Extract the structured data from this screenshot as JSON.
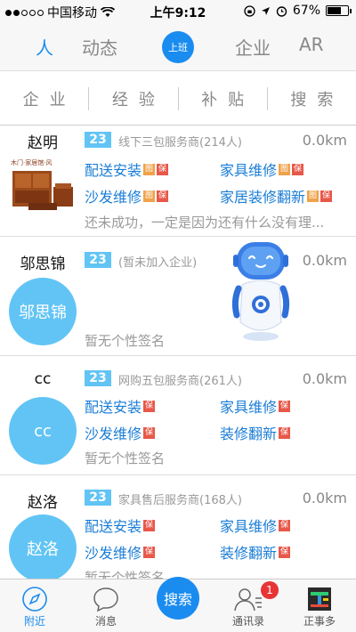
{
  "status": {
    "carrier": "中国移动",
    "time": "上午9:12",
    "battery": "67%",
    "battery_level": 0.67
  },
  "topnav": {
    "tabs": [
      {
        "label": "人",
        "active": true
      },
      {
        "label": "动态",
        "active": false
      },
      {
        "label": "企业",
        "active": false
      },
      {
        "label": "AR",
        "active": false
      }
    ],
    "center_button": "上班"
  },
  "filters": [
    "企业",
    "经验",
    "补贴",
    "搜索"
  ],
  "cards": [
    {
      "name": "赵明",
      "level": "23",
      "category": "线下三包服务商(214人)",
      "distance": "0.0km",
      "services": [
        {
          "label": "配送安装",
          "badges": [
            "图",
            "保"
          ]
        },
        {
          "label": "家具维修",
          "badges": [
            "图",
            "保"
          ]
        },
        {
          "label": "沙发维修",
          "badges": [
            "图",
            "保"
          ]
        },
        {
          "label": "家居装修翻新",
          "badges": [
            "图",
            "保"
          ]
        }
      ],
      "signature": "还未成功，一定是因为还有什么没有理..."
    },
    {
      "name": "邬思锦",
      "avatar_text": "邬思锦",
      "level": "23",
      "category": "(暂未加入企业)",
      "distance": "0.0km",
      "services": [],
      "signature": "暂无个性签名"
    },
    {
      "name": "cc",
      "avatar_text": "cc",
      "level": "23",
      "category": "网购五包服务商(261人)",
      "distance": "0.0km",
      "services": [
        {
          "label": "配送安装",
          "badges": [
            "保"
          ]
        },
        {
          "label": "家具维修",
          "badges": [
            "保"
          ]
        },
        {
          "label": "沙发维修",
          "badges": [
            "保"
          ]
        },
        {
          "label": "装修翻新",
          "badges": [
            "保"
          ]
        }
      ],
      "signature": "暂无个性签名"
    },
    {
      "name": "赵洛",
      "avatar_text": "赵洛",
      "level": "23",
      "category": "家具售后服务商(168人)",
      "distance": "0.0km",
      "services": [
        {
          "label": "配送安装",
          "badges": [
            "保"
          ]
        },
        {
          "label": "家具维修",
          "badges": [
            "保"
          ]
        },
        {
          "label": "沙发维修",
          "badges": [
            "保"
          ]
        },
        {
          "label": "装修翻新",
          "badges": [
            "保"
          ]
        }
      ],
      "signature": "暂无个性签名"
    }
  ],
  "tabbar": {
    "items": [
      {
        "label": "附近",
        "icon": "compass-icon",
        "active": true
      },
      {
        "label": "消息",
        "icon": "chat-bubble-icon"
      },
      {
        "label": "搜索",
        "icon": "search-button"
      },
      {
        "label": "通讯录",
        "icon": "contacts-icon",
        "badge": "1"
      },
      {
        "label": "正事多",
        "icon": "app-logo-icon"
      }
    ]
  },
  "colors": {
    "accent": "#1a8cf0",
    "avatar": "#61c4f5",
    "service_link": "#1a7dd6",
    "badge_image": "#f0a24a",
    "badge_guarantee": "#e8584a",
    "notification": "#e83434"
  }
}
